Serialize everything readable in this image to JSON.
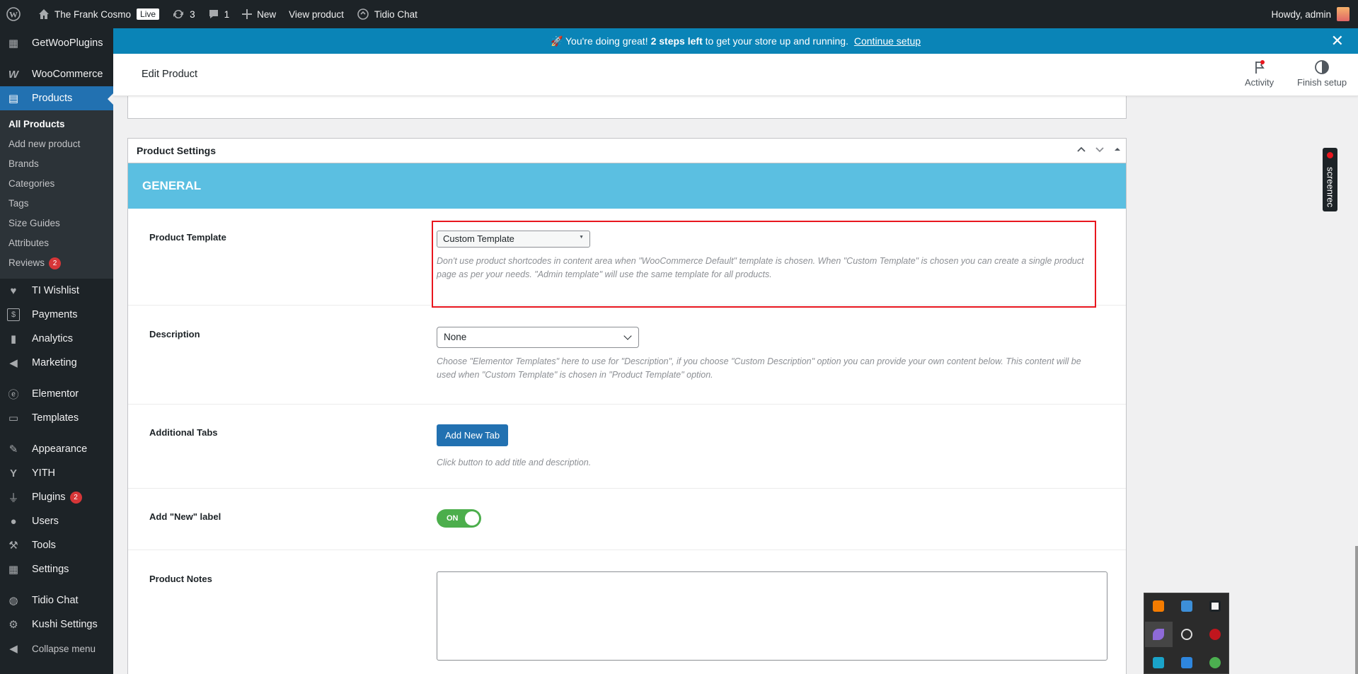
{
  "adminbar": {
    "site_name": "The Frank Cosmo",
    "live_badge": "Live",
    "updates_count": "3",
    "comments_count": "1",
    "new_label": "New",
    "view_product_label": "View product",
    "tidio_label": "Tidio Chat",
    "howdy": "Howdy, admin"
  },
  "sidebar": {
    "top_items": [
      {
        "label": "GetWooPlugins",
        "icon": "dashboard-icon"
      },
      {
        "label": "WooCommerce",
        "icon": "woocommerce-icon"
      },
      {
        "label": "Products",
        "icon": "archive-icon"
      }
    ],
    "submenu": [
      {
        "label": "All Products"
      },
      {
        "label": "Add new product"
      },
      {
        "label": "Brands"
      },
      {
        "label": "Categories"
      },
      {
        "label": "Tags"
      },
      {
        "label": "Size Guides"
      },
      {
        "label": "Attributes"
      },
      {
        "label": "Reviews",
        "badge": "2"
      }
    ],
    "items": [
      {
        "label": "TI Wishlist",
        "icon": "heart-icon"
      },
      {
        "label": "Payments",
        "icon": "dollar-icon"
      },
      {
        "label": "Analytics",
        "icon": "bar-chart-icon"
      },
      {
        "label": "Marketing",
        "icon": "megaphone-icon"
      },
      {
        "label": "Elementor",
        "icon": "elementor-icon"
      },
      {
        "label": "Templates",
        "icon": "folder-icon"
      },
      {
        "label": "Appearance",
        "icon": "brush-icon"
      },
      {
        "label": "YITH",
        "icon": "yith-icon"
      },
      {
        "label": "Plugins",
        "icon": "plug-icon",
        "badge": "2"
      },
      {
        "label": "Users",
        "icon": "user-icon"
      },
      {
        "label": "Tools",
        "icon": "wrench-icon"
      },
      {
        "label": "Settings",
        "icon": "settings-icon"
      },
      {
        "label": "Tidio Chat",
        "icon": "chat-icon"
      },
      {
        "label": "Kushi Settings",
        "icon": "gear-icon"
      },
      {
        "label": "Collapse menu",
        "icon": "collapse-icon"
      }
    ]
  },
  "notice": {
    "prefix": "🚀 You're doing great! ",
    "bold": "2 steps left",
    "middle": " to get your store up and running. ",
    "link": "Continue setup"
  },
  "header": {
    "title": "Edit Product",
    "activity": "Activity",
    "finish_setup": "Finish setup"
  },
  "product_settings": {
    "title": "Product Settings",
    "section": "GENERAL",
    "template": {
      "label": "Product Template",
      "value": "Custom Template",
      "description": "Don't use product shortcodes in content area when \"WooCommerce Default\" template is chosen. When \"Custom Template\" is chosen you can create a single product page as per your needs. \"Admin template\" will use the same template for all products."
    },
    "description": {
      "label": "Description",
      "value": "None",
      "help": "Choose \"Elementor Templates\" here to use for \"Description\", if you choose \"Custom Description\" option you can provide your own content below. This content will be used when \"Custom Template\" is chosen in \"Product Template\" option."
    },
    "tabs": {
      "label": "Additional Tabs",
      "button": "Add New Tab",
      "help": "Click button to add title and description."
    },
    "new_label": {
      "label": "Add \"New\" label",
      "toggle": "ON"
    },
    "notes": {
      "label": "Product Notes"
    }
  },
  "screenrec": "screenrec",
  "colors": {
    "accent": "#2271b1",
    "notice": "#0a84b7",
    "general": "#5bbfe1",
    "highlight": "#e8161e",
    "toggle_on": "#4cae4c"
  }
}
